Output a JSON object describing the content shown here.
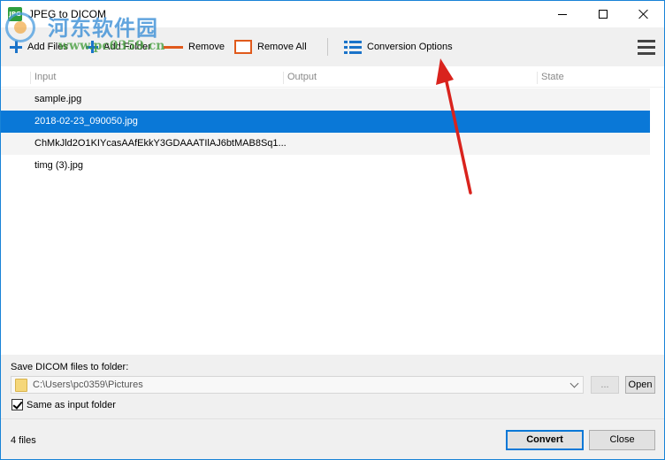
{
  "window": {
    "title": "JPEG to DICOM",
    "app_icon_text": "JPG"
  },
  "watermark": {
    "name": "河东软件园",
    "url": "www.pc0359.cn"
  },
  "toolbar": {
    "add_files": "Add Files",
    "add_folder": "Add Folder",
    "remove": "Remove",
    "remove_all": "Remove All",
    "conversion_options": "Conversion Options"
  },
  "list": {
    "columns": [
      "Input",
      "Output",
      "State"
    ],
    "rows": [
      {
        "input": "sample.jpg",
        "output": "",
        "state": "",
        "selected": false
      },
      {
        "input": "2018-02-23_090050.jpg",
        "output": "",
        "state": "",
        "selected": true
      },
      {
        "input": "ChMkJld2O1KIYcasAAfEkkY3GDAAATIlAJ6btMAB8Sq1...",
        "output": "",
        "state": "",
        "selected": false
      },
      {
        "input": "timg (3).jpg",
        "output": "",
        "state": "",
        "selected": false
      }
    ]
  },
  "save": {
    "label": "Save DICOM files to folder:",
    "folder_path": "C:\\Users\\pc0359\\Pictures",
    "browse_label": "...",
    "open_label": "Open",
    "same_as_input_label": "Same as input folder",
    "same_as_input_checked": true
  },
  "status": {
    "files_count": "4 files",
    "convert_label": "Convert",
    "close_label": "Close"
  },
  "colors": {
    "accent": "#0a78d7",
    "remove_icon": "#e05a1c",
    "add_icon": "#1a73c9",
    "annotation_arrow": "#d9231d"
  }
}
